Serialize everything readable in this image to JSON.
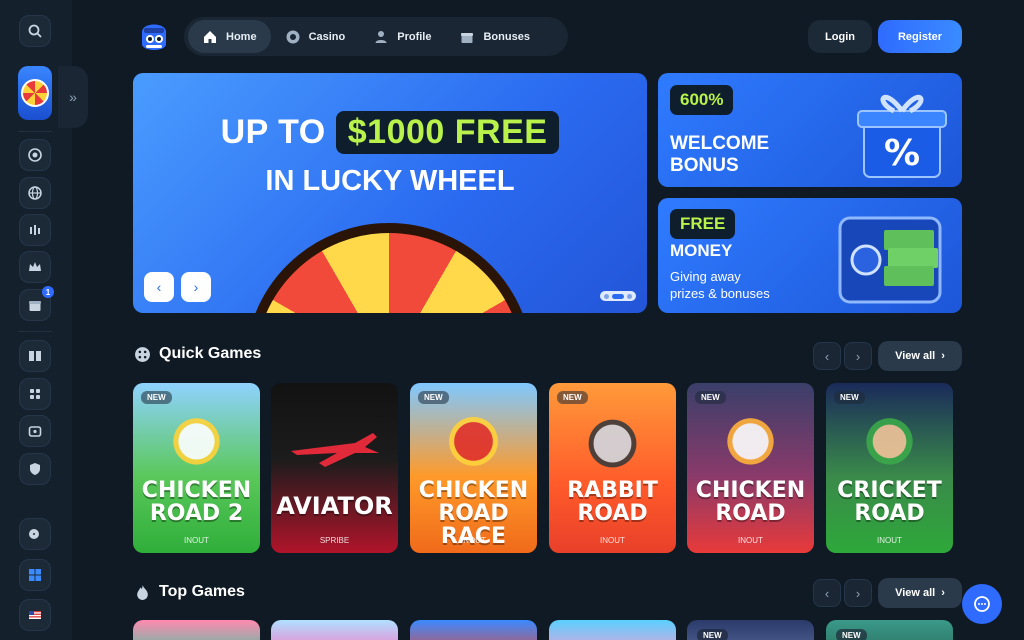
{
  "nav": {
    "items": [
      {
        "label": "Home",
        "icon": "home-icon",
        "active": true
      },
      {
        "label": "Casino",
        "icon": "chip-icon",
        "active": false
      },
      {
        "label": "Profile",
        "icon": "user-icon",
        "active": false
      },
      {
        "label": "Bonuses",
        "icon": "gift-icon",
        "active": false
      }
    ]
  },
  "auth": {
    "login": "Login",
    "register": "Register"
  },
  "sidebar": {
    "gift_badge": "1"
  },
  "hero": {
    "line1_a": "UP TO",
    "line1_b": "$1000 FREE",
    "line2": "IN LUCKY WHEEL"
  },
  "promos": [
    {
      "tag": "600%",
      "title_1": "WELCOME",
      "title_2": "BONUS"
    },
    {
      "tag": "FREE",
      "title_1": "MONEY",
      "sub_1": "Giving away",
      "sub_2": "prizes & bonuses"
    }
  ],
  "quick_games": {
    "title": "Quick Games",
    "view_all": "View all",
    "games": [
      {
        "title_1": "CHICKEN",
        "title_2": "ROAD 2",
        "provider": "INOUT",
        "new": "NEW"
      },
      {
        "title_1": "AVIATOR",
        "title_2": "",
        "provider": "SPRIBE",
        "new": ""
      },
      {
        "title_1": "CHICKEN",
        "title_2": "ROAD RACE",
        "provider": "INOUT",
        "new": "NEW"
      },
      {
        "title_1": "RABBIT",
        "title_2": "ROAD",
        "provider": "INOUT",
        "new": "NEW"
      },
      {
        "title_1": "CHICKEN",
        "title_2": "ROAD",
        "provider": "INOUT",
        "new": "NEW"
      },
      {
        "title_1": "CRICKET",
        "title_2": "ROAD",
        "provider": "INOUT",
        "new": "NEW"
      }
    ]
  },
  "top_games": {
    "title": "Top Games",
    "view_all": "View all",
    "badges": [
      "",
      "",
      "",
      "",
      "NEW",
      "NEW"
    ]
  },
  "colors": {
    "accent": "#2f6bff",
    "highlight": "#b8f24a",
    "bg": "#0f1a24"
  }
}
